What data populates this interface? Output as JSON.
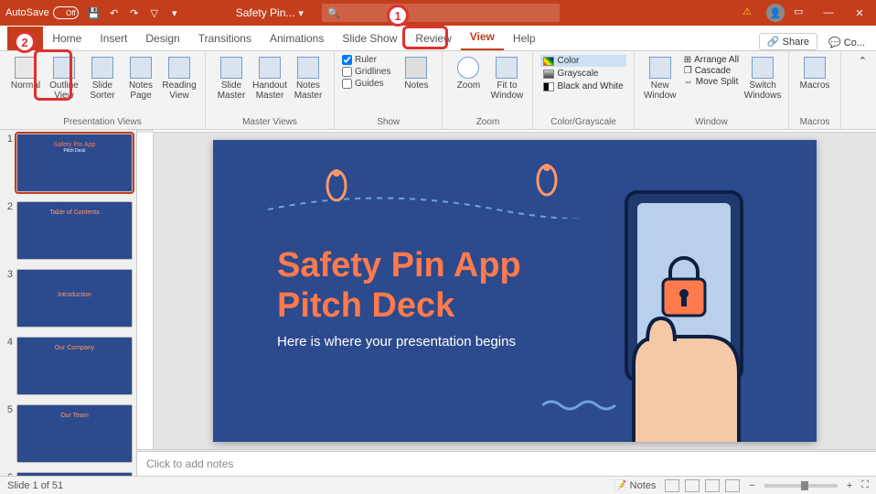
{
  "titlebar": {
    "autosave_label": "AutoSave",
    "autosave_state": "Off",
    "doc_title": "Safety Pin...",
    "search_placeholder": "Search"
  },
  "tabs": {
    "file": "File",
    "items": [
      "Home",
      "Insert",
      "Design",
      "Transitions",
      "Animations",
      "Slide Show",
      "Review",
      "View",
      "Help"
    ],
    "active_index": 7,
    "share": "Share",
    "comments": "Co..."
  },
  "ribbon": {
    "group_presentation": {
      "label": "Presentation Views",
      "buttons": [
        {
          "label": "Normal"
        },
        {
          "label": "Outline View"
        },
        {
          "label": "Slide Sorter"
        },
        {
          "label": "Notes Page"
        },
        {
          "label": "Reading View"
        }
      ]
    },
    "group_master": {
      "label": "Master Views",
      "buttons": [
        {
          "label": "Slide Master"
        },
        {
          "label": "Handout Master"
        },
        {
          "label": "Notes Master"
        }
      ]
    },
    "group_show": {
      "label": "Show",
      "checks": [
        {
          "label": "Ruler",
          "checked": true
        },
        {
          "label": "Gridlines",
          "checked": false
        },
        {
          "label": "Guides",
          "checked": false
        }
      ],
      "notes_btn": "Notes"
    },
    "group_zoom": {
      "label": "Zoom",
      "zoom_btn": "Zoom",
      "fit_btn": "Fit to Window"
    },
    "group_color": {
      "label": "Color/Grayscale",
      "opts": [
        {
          "label": "Color",
          "selected": true
        },
        {
          "label": "Grayscale",
          "selected": false
        },
        {
          "label": "Black and White",
          "selected": false
        }
      ]
    },
    "group_window": {
      "label": "Window",
      "new_win": "New Window",
      "opts": [
        "Arrange All",
        "Cascade",
        "Move Split"
      ],
      "switch": "Switch Windows"
    },
    "group_macros": {
      "label": "Macros",
      "btn": "Macros"
    }
  },
  "thumbs": [
    {
      "n": 1,
      "title": "Safety Pin App",
      "sub": "Pitch Deck",
      "active": true
    },
    {
      "n": 2,
      "title": "Table of Contents",
      "sub": ""
    },
    {
      "n": 3,
      "title": "Introduction",
      "sub": ""
    },
    {
      "n": 4,
      "title": "Our Company",
      "sub": ""
    },
    {
      "n": 5,
      "title": "Our Team",
      "sub": ""
    },
    {
      "n": 6,
      "title": "",
      "sub": ""
    }
  ],
  "slide": {
    "title_line1": "Safety Pin App",
    "title_line2": "Pitch Deck",
    "subtitle": "Here is where your presentation begins"
  },
  "notes_placeholder": "Click to add notes",
  "status": {
    "slide_info": "Slide 1 of 51",
    "notes_btn": "Notes",
    "zoom_minus": "−",
    "zoom_plus": "+"
  },
  "callouts": {
    "c1": "1",
    "c2": "2"
  },
  "colors": {
    "brand": "#c43e1c",
    "slide_bg": "#2c4a8e",
    "accent": "#ff7a4d"
  }
}
